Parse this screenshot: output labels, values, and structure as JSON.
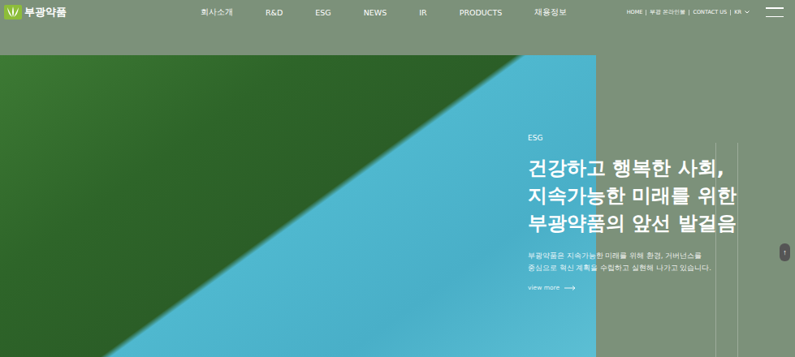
{
  "header": {
    "logo": "부광약품",
    "nav": [
      {
        "label": "회사소개"
      },
      {
        "label": "R&D"
      },
      {
        "label": "ESG"
      },
      {
        "label": "NEWS"
      },
      {
        "label": "IR"
      },
      {
        "label": "PRODUCTS"
      },
      {
        "label": "채용정보"
      }
    ],
    "utility": [
      "HOME",
      "부광 온라인몰",
      "CONTACT US"
    ],
    "language": "KR"
  },
  "hero": {
    "eyebrow": "ESG",
    "headline": [
      "건강하고 행복한 사회,",
      "지속가능한 미래를 위한",
      "부광약품의 앞선 발걸음"
    ],
    "description": [
      "부광약품은 지속가능한 미래를 위해 환경, 거버넌스를",
      "중심으로 혁신 계획을 수립하고 실현해 나가고 있습니다."
    ],
    "link": "view more"
  },
  "scroll_top": "↑"
}
